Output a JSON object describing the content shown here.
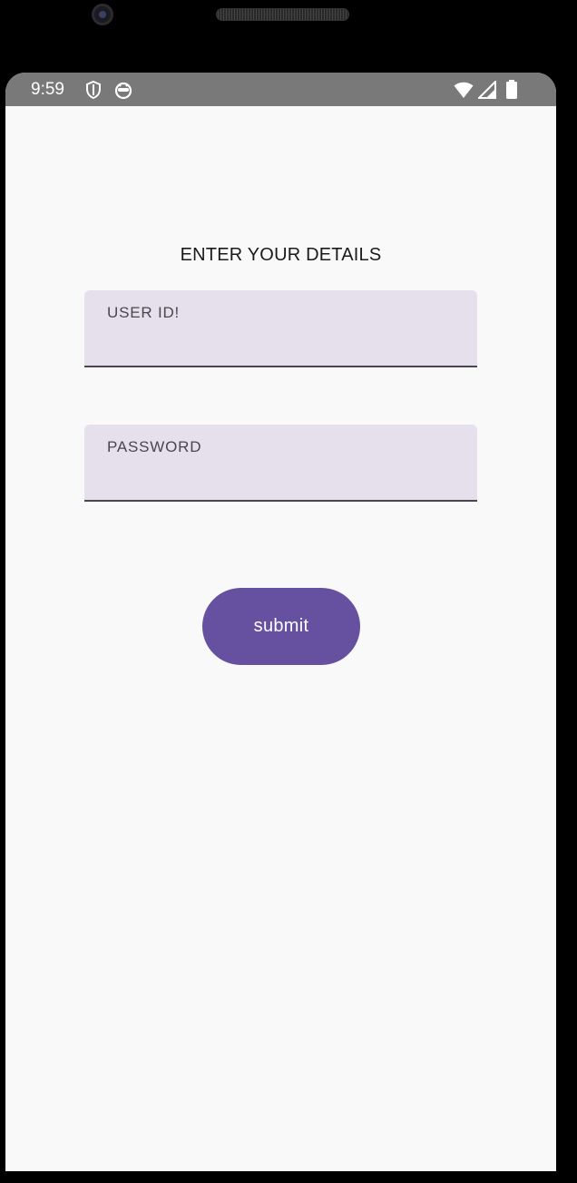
{
  "status_bar": {
    "time": "9:59",
    "left_icons": [
      "shield-icon",
      "app-notification-icon"
    ],
    "right_icons": [
      "wifi-icon",
      "signal-icon",
      "battery-icon"
    ]
  },
  "form": {
    "title": "ENTER YOUR DETAILS",
    "user_id": {
      "label": "USER ID!",
      "value": ""
    },
    "password": {
      "label": "PASSWORD",
      "value": ""
    },
    "submit_label": "submit"
  },
  "colors": {
    "status_bar": "#797979",
    "background": "#f9f9f9",
    "field_fill": "#e6e0ec",
    "field_underline": "#4a4650",
    "primary": "#6650a0"
  }
}
